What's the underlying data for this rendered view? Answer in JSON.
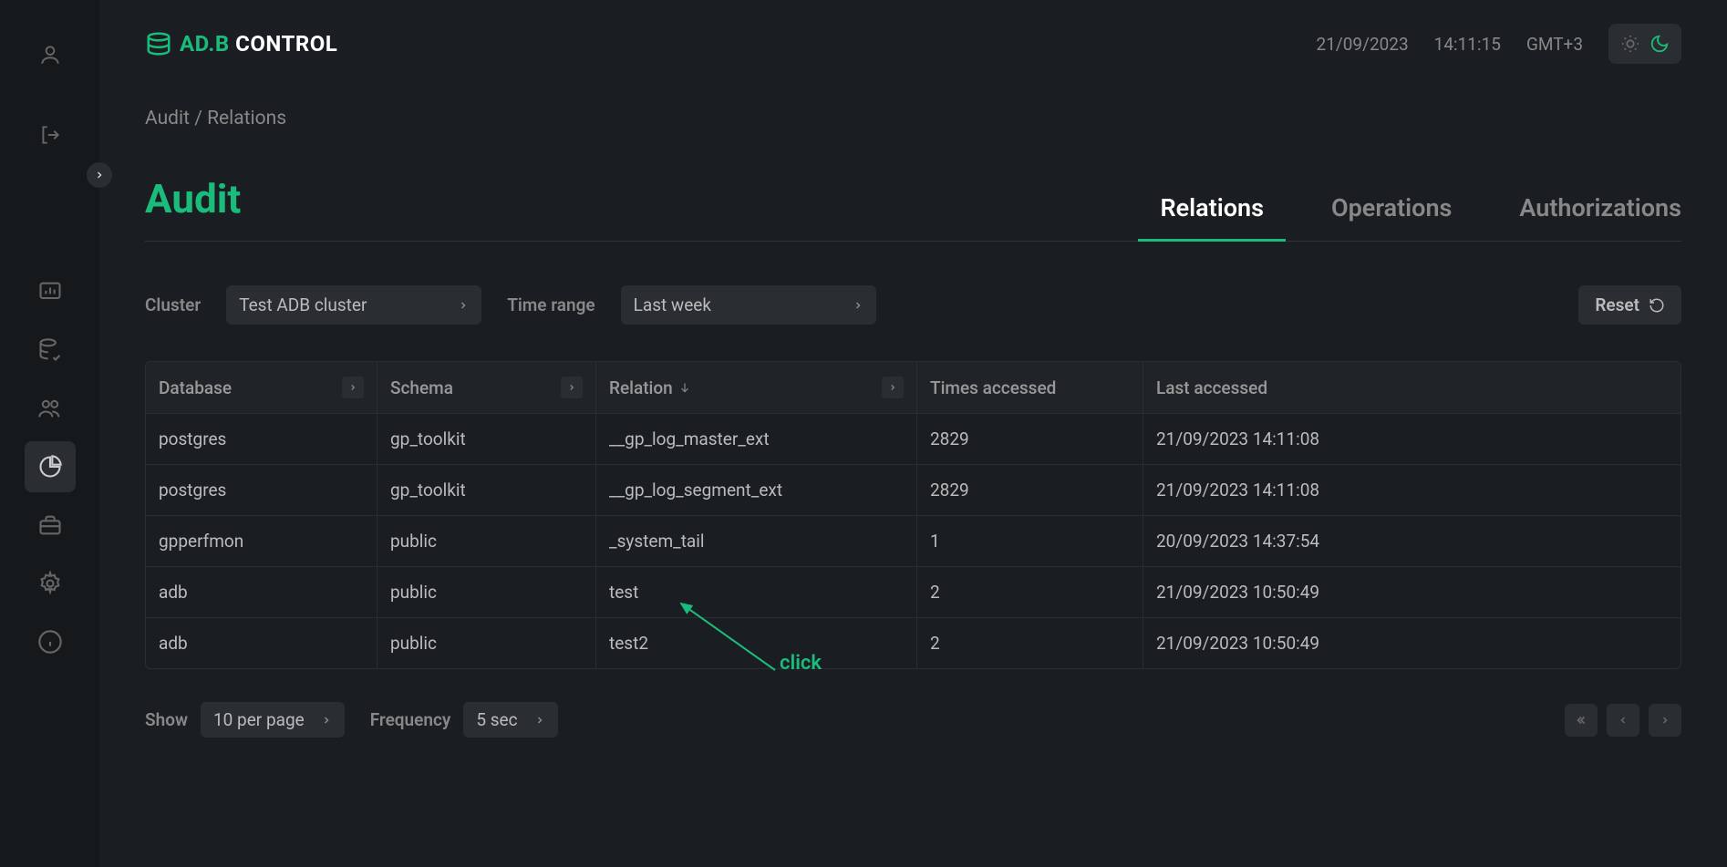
{
  "header": {
    "logoGreen": "AD.B",
    "logoWhite": " CONTROL",
    "date": "21/09/2023",
    "time": "14:11:15",
    "tz": "GMT+3"
  },
  "breadcrumb": {
    "root": "Audit",
    "current": "Relations"
  },
  "pageTitle": "Audit",
  "tabs": [
    "Relations",
    "Operations",
    "Authorizations"
  ],
  "filters": {
    "clusterLabel": "Cluster",
    "clusterValue": "Test ADB cluster",
    "timeLabel": "Time range",
    "timeValue": "Last week",
    "resetLabel": "Reset"
  },
  "table": {
    "columns": [
      "Database",
      "Schema",
      "Relation",
      "Times accessed",
      "Last accessed"
    ],
    "rows": [
      {
        "database": "postgres",
        "schema": "gp_toolkit",
        "relation": "__gp_log_master_ext",
        "times": "2829",
        "last": "21/09/2023 14:11:08"
      },
      {
        "database": "postgres",
        "schema": "gp_toolkit",
        "relation": "__gp_log_segment_ext",
        "times": "2829",
        "last": "21/09/2023 14:11:08"
      },
      {
        "database": "gpperfmon",
        "schema": "public",
        "relation": "_system_tail",
        "times": "1",
        "last": "20/09/2023 14:37:54"
      },
      {
        "database": "adb",
        "schema": "public",
        "relation": "test",
        "times": "2",
        "last": "21/09/2023 10:50:49"
      },
      {
        "database": "adb",
        "schema": "public",
        "relation": "test2",
        "times": "2",
        "last": "21/09/2023 10:50:49"
      }
    ]
  },
  "pager": {
    "showLabel": "Show",
    "perPage": "10 per page",
    "freqLabel": "Frequency",
    "freqValue": "5 sec"
  },
  "annotation": "click"
}
